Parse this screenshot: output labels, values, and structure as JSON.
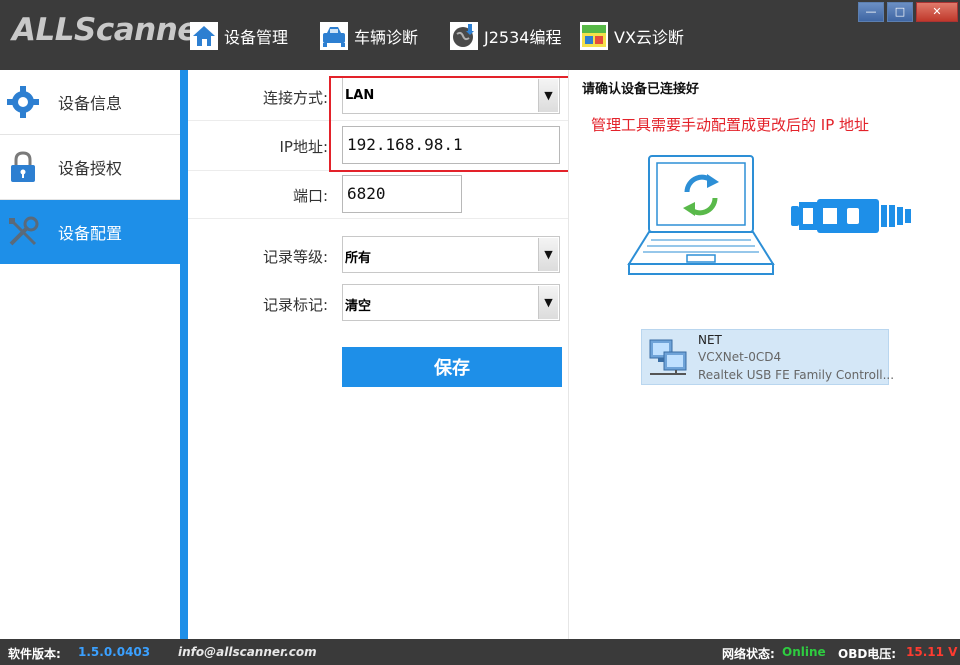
{
  "app": {
    "logo_text": "ALLScanner"
  },
  "nav": [
    {
      "label": "设备管理",
      "icon": "home-icon"
    },
    {
      "label": "车辆诊断",
      "icon": "car-icon"
    },
    {
      "label": "J2534编程",
      "icon": "globe-download-icon"
    },
    {
      "label": "VX云诊断",
      "icon": "cloud-diagnosis-icon"
    }
  ],
  "window_controls": {
    "minimize": "—",
    "maximize": "□",
    "close": "✕"
  },
  "sidebar": {
    "items": [
      {
        "label": "设备信息",
        "icon": "gear-icon",
        "active": false
      },
      {
        "label": "设备授权",
        "icon": "lock-icon",
        "active": false
      },
      {
        "label": "设备配置",
        "icon": "tools-icon",
        "active": true
      }
    ]
  },
  "form": {
    "connection": {
      "label": "连接方式:",
      "value": "LAN"
    },
    "ip": {
      "label": "IP地址:",
      "value": "192.168.98.1"
    },
    "port": {
      "label": "端口:",
      "value": "6820"
    },
    "log_level": {
      "label": "记录等级:",
      "value": "所有"
    },
    "log_mark": {
      "label": "记录标记:",
      "value": "清空"
    },
    "save_label": "保存"
  },
  "right": {
    "title": "请确认设备已连接好",
    "warning": "管理工具需要手动配置成更改后的 IP 地址",
    "net": {
      "name": "NET",
      "device": "VCXNet-0CD4",
      "adapter": "Realtek USB FE Family Controll..."
    }
  },
  "status": {
    "version_label": "软件版本:",
    "version": "1.5.0.0403",
    "email": "info@allscanner.com",
    "net_label": "网络状态:",
    "net_value": "Online",
    "obd_label": "OBD电压:",
    "obd_value": "15.11 V"
  },
  "colors": {
    "accent": "#1e8fe8",
    "warning": "#e3222a",
    "online": "#2ecc40",
    "voltage": "#ff3b30"
  }
}
